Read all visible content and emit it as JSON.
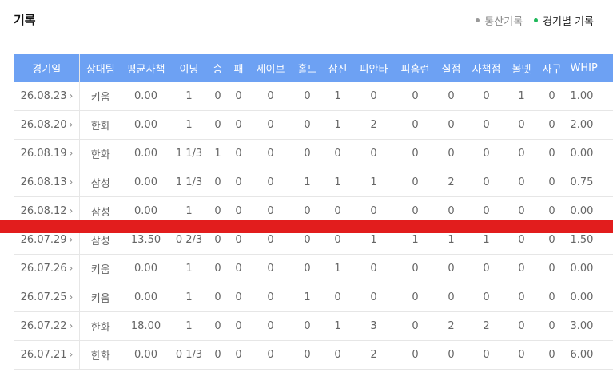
{
  "header": {
    "title": "기록",
    "tabs": [
      {
        "label": "통산기록",
        "active": false
      },
      {
        "label": "경기별 기록",
        "active": true
      }
    ]
  },
  "colors": {
    "header_bg": "#6da1f3",
    "active_dot": "#1fb85a",
    "overlay_bar": "#e21d1d"
  },
  "table": {
    "columns": [
      "경기일",
      "상대팀",
      "평균자책",
      "이닝",
      "승",
      "패",
      "세이브",
      "홀드",
      "삼진",
      "피안타",
      "피홈런",
      "실점",
      "자책점",
      "볼넷",
      "사구",
      "WHIP"
    ],
    "rows": [
      [
        "26.08.23",
        "키움",
        "0.00",
        "1",
        "0",
        "0",
        "0",
        "0",
        "1",
        "0",
        "0",
        "0",
        "0",
        "1",
        "0",
        "1.00"
      ],
      [
        "26.08.20",
        "한화",
        "0.00",
        "1",
        "0",
        "0",
        "0",
        "0",
        "1",
        "2",
        "0",
        "0",
        "0",
        "0",
        "0",
        "2.00"
      ],
      [
        "26.08.19",
        "한화",
        "0.00",
        "1 1/3",
        "1",
        "0",
        "0",
        "0",
        "0",
        "0",
        "0",
        "0",
        "0",
        "0",
        "0",
        "0.00"
      ],
      [
        "26.08.13",
        "삼성",
        "0.00",
        "1 1/3",
        "0",
        "0",
        "0",
        "1",
        "1",
        "1",
        "0",
        "2",
        "0",
        "0",
        "0",
        "0.75"
      ],
      [
        "26.08.12",
        "삼성",
        "0.00",
        "1",
        "0",
        "0",
        "0",
        "0",
        "0",
        "0",
        "0",
        "0",
        "0",
        "0",
        "0",
        "0.00"
      ],
      [
        "26.07.29",
        "삼성",
        "13.50",
        "0 2/3",
        "0",
        "0",
        "0",
        "0",
        "0",
        "1",
        "1",
        "1",
        "1",
        "0",
        "0",
        "1.50"
      ],
      [
        "26.07.26",
        "키움",
        "0.00",
        "1",
        "0",
        "0",
        "0",
        "0",
        "1",
        "0",
        "0",
        "0",
        "0",
        "0",
        "0",
        "0.00"
      ],
      [
        "26.07.25",
        "키움",
        "0.00",
        "1",
        "0",
        "0",
        "0",
        "1",
        "0",
        "0",
        "0",
        "0",
        "0",
        "0",
        "0",
        "0.00"
      ],
      [
        "26.07.22",
        "한화",
        "18.00",
        "1",
        "0",
        "0",
        "0",
        "0",
        "1",
        "3",
        "0",
        "2",
        "2",
        "0",
        "0",
        "3.00"
      ],
      [
        "26.07.21",
        "한화",
        "0.00",
        "0 1/3",
        "0",
        "0",
        "0",
        "0",
        "0",
        "2",
        "0",
        "0",
        "0",
        "0",
        "0",
        "6.00"
      ]
    ]
  }
}
